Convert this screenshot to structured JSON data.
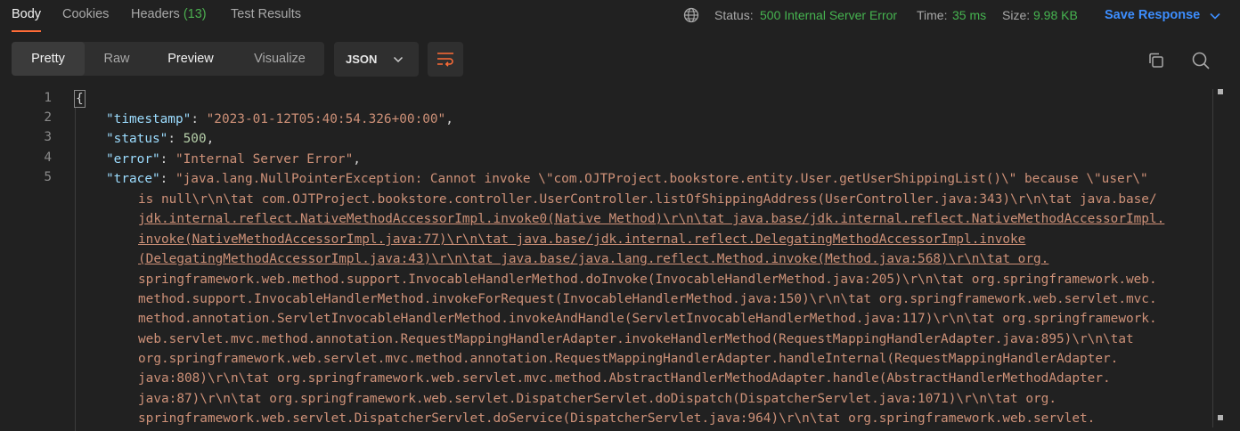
{
  "response_tabs": [
    {
      "label": "Body"
    },
    {
      "label": "Cookies"
    },
    {
      "label": "Headers",
      "count": "(13)"
    },
    {
      "label": "Test Results"
    }
  ],
  "status": {
    "status_label": "Status:",
    "status_value": "500 Internal Server Error",
    "time_label": "Time:",
    "time_value": "35 ms",
    "size_label": "Size:",
    "size_value": "9.98 KB",
    "save_label": "Save Response"
  },
  "view_modes": [
    "Pretty",
    "Raw",
    "Preview",
    "Visualize"
  ],
  "format": {
    "selected": "JSON"
  },
  "editor": {
    "line_numbers": [
      "1",
      "2",
      "3",
      "4",
      "5"
    ],
    "timestamp_key": "\"timestamp\"",
    "timestamp_val": "\"2023-01-12T05:40:54.326+00:00\"",
    "status_key": "\"status\"",
    "status_val": "500",
    "error_key": "\"error\"",
    "error_val": "\"Internal Server Error\"",
    "trace_key": "\"trace\"",
    "trace_lines": [
      "\"java.lang.NullPointerException: Cannot invoke \\\"com.OJTProject.bookstore.entity.User.getUserShippingList()\\\" because \\\"user\\\"",
      "is null\\r\\n\\tat com.OJTProject.bookstore.controller.UserController.listOfShippingAddress(UserController.java:343)\\r\\n\\tat java.base/",
      "jdk.internal.reflect.NativeMethodAccessorImpl.invoke0(Native Method)\\r\\n\\tat java.base/jdk.internal.reflect.NativeMethodAccessorImpl.",
      "invoke(NativeMethodAccessorImpl.java:77)\\r\\n\\tat java.base/jdk.internal.reflect.DelegatingMethodAccessorImpl.invoke",
      "(DelegatingMethodAccessorImpl.java:43)\\r\\n\\tat java.base/java.lang.reflect.Method.invoke(Method.java:568)\\r\\n\\tat org.",
      "springframework.web.method.support.InvocableHandlerMethod.doInvoke(InvocableHandlerMethod.java:205)\\r\\n\\tat org.springframework.web.",
      "method.support.InvocableHandlerMethod.invokeForRequest(InvocableHandlerMethod.java:150)\\r\\n\\tat org.springframework.web.servlet.mvc.",
      "method.annotation.ServletInvocableHandlerMethod.invokeAndHandle(ServletInvocableHandlerMethod.java:117)\\r\\n\\tat org.springframework.",
      "web.servlet.mvc.method.annotation.RequestMappingHandlerAdapter.invokeHandlerMethod(RequestMappingHandlerAdapter.java:895)\\r\\n\\tat",
      "org.springframework.web.servlet.mvc.method.annotation.RequestMappingHandlerAdapter.handleInternal(RequestMappingHandlerAdapter.",
      "java:808)\\r\\n\\tat org.springframework.web.servlet.mvc.method.AbstractHandlerMethodAdapter.handle(AbstractHandlerMethodAdapter.",
      "java:87)\\r\\n\\tat org.springframework.web.servlet.DispatcherServlet.doDispatch(DispatcherServlet.java:1071)\\r\\n\\tat org.",
      "springframework.web.servlet.DispatcherServlet.doService(DispatcherServlet.java:964)\\r\\n\\tat org.springframework.web.servlet."
    ]
  },
  "icons": {
    "globe": "globe-icon",
    "chevron": "chevron-down-icon",
    "wrap": "wrap-lines-icon",
    "copy": "copy-icon",
    "search": "search-icon"
  },
  "colors": {
    "accent": "#ff6c37",
    "status_ok": "#46b450",
    "link": "#3d8eff",
    "json_key": "#9cdcfe",
    "json_string": "#ce9178",
    "json_number": "#b5cea8"
  }
}
